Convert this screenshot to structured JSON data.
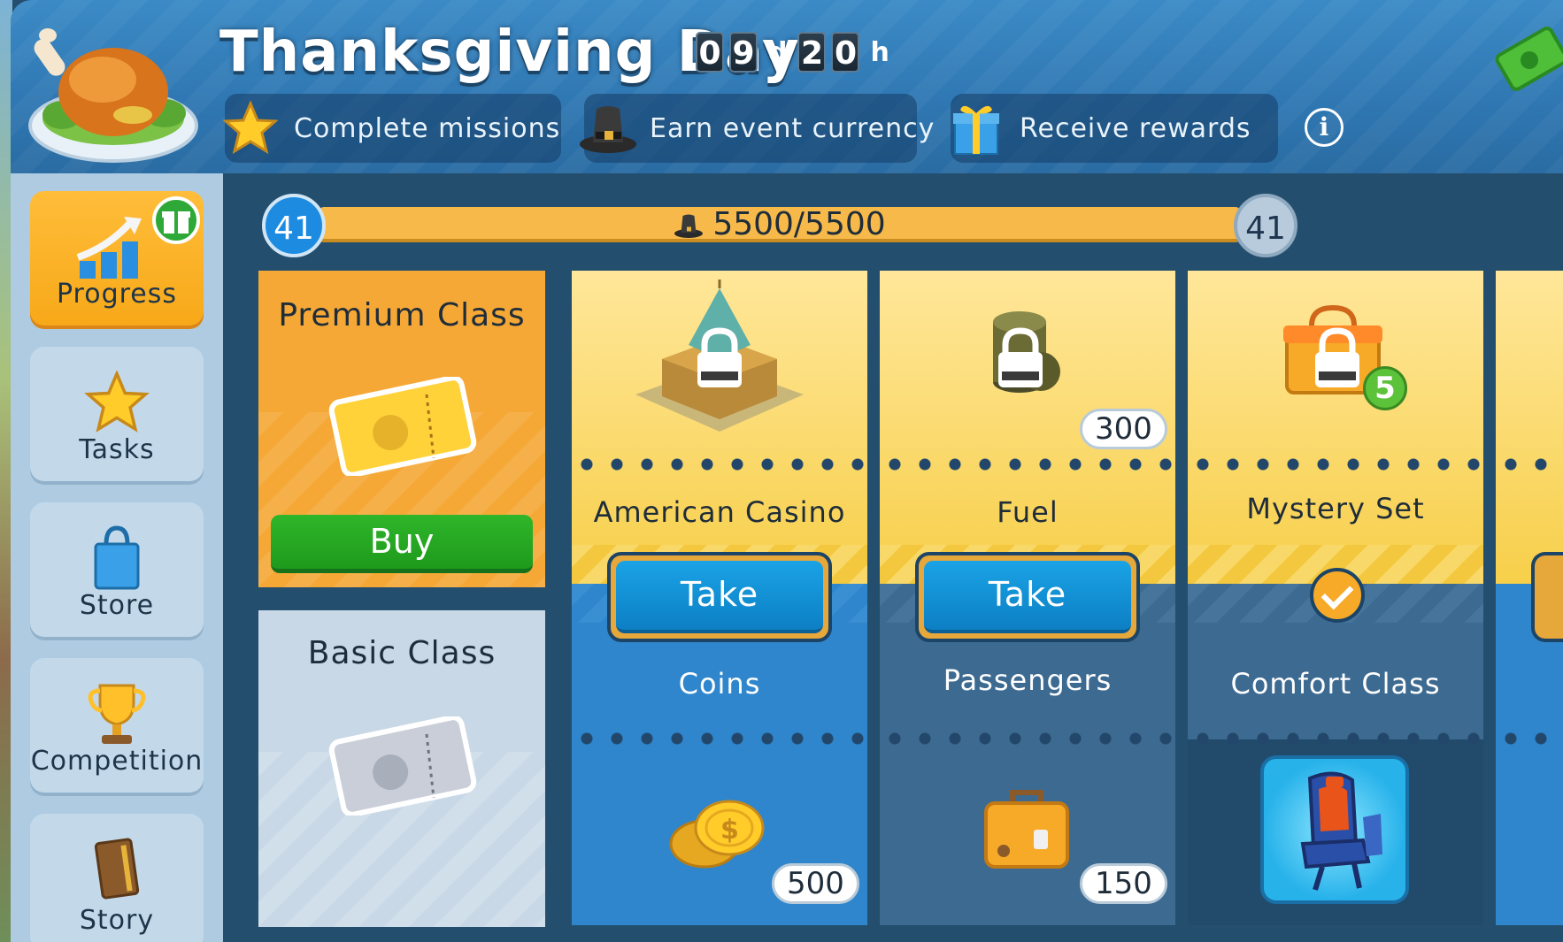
{
  "event": {
    "title": "Thanksgiving Day",
    "timer": {
      "days_digits": [
        "0",
        "9"
      ],
      "days_unit": "d",
      "hours_digits": [
        "2",
        "0"
      ],
      "hours_unit": "h"
    },
    "steps": [
      "Complete missions",
      "Earn event currency",
      "Receive rewards"
    ],
    "info_symbol": "i"
  },
  "sidebar": {
    "items": [
      {
        "label": "Progress",
        "icon": "progress-chart-icon",
        "active": true
      },
      {
        "label": "Tasks",
        "icon": "star-icon",
        "active": false
      },
      {
        "label": "Store",
        "icon": "shopping-bag-icon",
        "active": false
      },
      {
        "label": "Competition",
        "icon": "trophy-icon",
        "active": false
      },
      {
        "label": "Story",
        "icon": "book-icon",
        "active": false
      }
    ]
  },
  "progress": {
    "level_current": "41",
    "level_next": "41",
    "points": "5500/5500",
    "fill_fraction": 1.0
  },
  "classes": {
    "premium": {
      "title": "Premium Class",
      "buy_label": "Buy"
    },
    "basic": {
      "title": "Basic Class"
    }
  },
  "rewards": [
    {
      "premium_name": "American Casino",
      "premium_qty": "",
      "basic_name": "Coins",
      "basic_qty": "500",
      "action": "Take"
    },
    {
      "premium_name": "Fuel",
      "premium_qty": "300",
      "basic_name": "Passengers",
      "basic_qty": "150",
      "action": "Take"
    },
    {
      "premium_name": "Mystery Set",
      "premium_qty": "",
      "premium_badge": "5",
      "basic_name": "Comfort Class",
      "basic_qty": "",
      "action": "claimed"
    }
  ],
  "colors": {
    "premium": "#f5a836",
    "basic": "#c8d8e6",
    "take": "#1aa3e6",
    "buy": "#2fb62a",
    "accent": "#f7a928"
  }
}
